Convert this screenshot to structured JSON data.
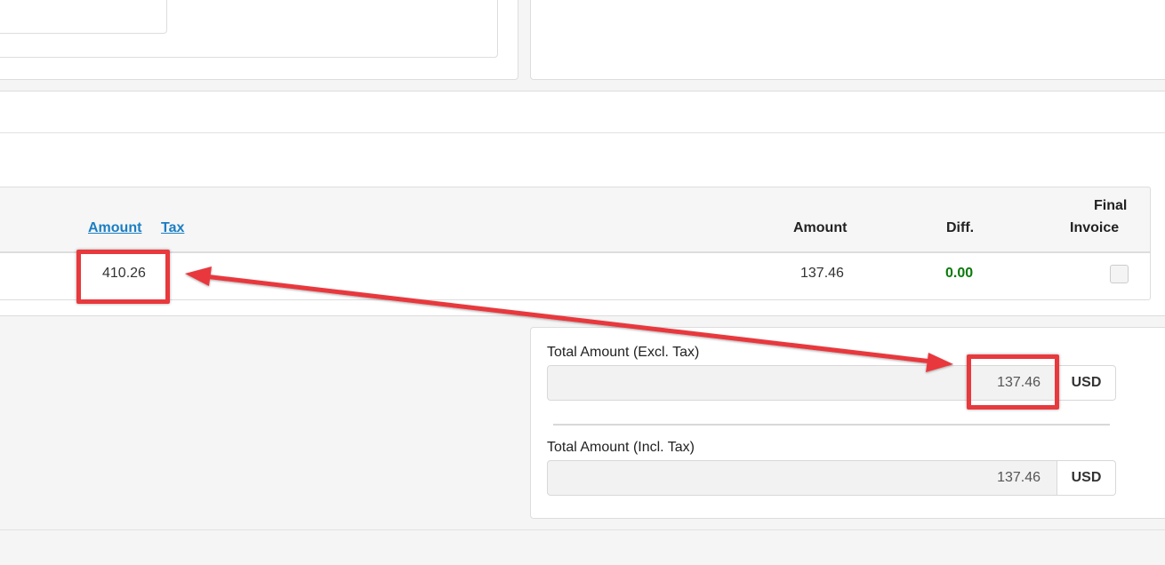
{
  "table": {
    "header_amount_link": "Amount",
    "header_tax_link": "Tax",
    "header_amount": "Amount",
    "header_diff": "Diff.",
    "header_final_invoice_line1": "Final",
    "header_final_invoice_line2": "Invoice",
    "row": {
      "amount_value": "410.26",
      "amount": "137.46",
      "diff": "0.00",
      "final_invoice_checked": false
    }
  },
  "totals": {
    "excl_label": "Total Amount (Excl. Tax)",
    "excl_value": "137.46",
    "excl_currency": "USD",
    "incl_label": "Total Amount (Incl. Tax)",
    "incl_value": "137.46",
    "incl_currency": "USD"
  },
  "colors": {
    "annotation": "#e8393d",
    "link": "#1a7ec2",
    "diff_positive": "#0a7a0a"
  }
}
